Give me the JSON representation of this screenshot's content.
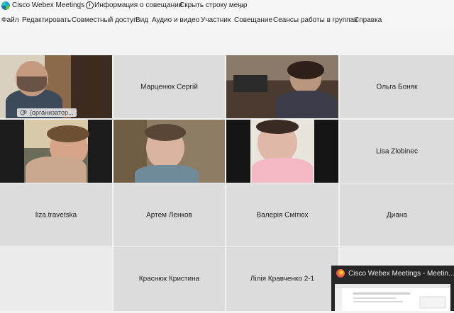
{
  "titlebar": {
    "app_title": "Cisco Webex Meetings",
    "info_label": "Информация о совещании",
    "hide_menu_label": "Скрыть строку меню",
    "hide_chevron": "︿"
  },
  "menu": [
    "Файл",
    "Редактировать",
    "Совместный доступ",
    "Вид",
    "Аудио и видео",
    "Участник",
    "Совещание",
    "Сеансы работы в группах",
    "Справка"
  ],
  "participants": {
    "organizer_label": "(организатор...",
    "name_1": "Марценюк Сергій",
    "name_2": "Ольга Боняк",
    "name_3": "Lisa Zlobinec",
    "name_4": "liza.travetska",
    "name_5": "Артем Ленков",
    "name_6": "Валерія Смітюх",
    "name_7": "Диана",
    "name_8": "Краснюк Кристина",
    "name_9": "Лілія Кравченко 2-1"
  },
  "thumbnail": {
    "title": "Cisco Webex Meetings - Meetin..."
  },
  "colors": {
    "selected_border": "#1ca6dc",
    "tile_bg": "#dcdcdc"
  }
}
